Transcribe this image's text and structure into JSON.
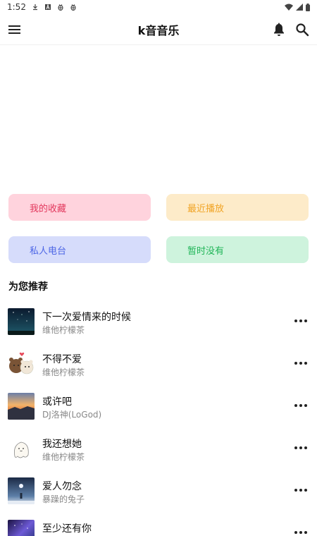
{
  "status_bar": {
    "time": "1:52",
    "icons": [
      "download-icon",
      "a-icon",
      "bug-icon",
      "bug-icon",
      "wifi-icon",
      "signal-icon",
      "battery-icon"
    ]
  },
  "app_bar": {
    "title": "k音音乐",
    "icons": [
      "menu-icon",
      "bell-icon",
      "search-icon"
    ]
  },
  "quick_actions": [
    {
      "label": "我的收藏",
      "bg": "#ffd3dd",
      "fg": "#e2375c"
    },
    {
      "label": "最近播放",
      "bg": "#fdebc9",
      "fg": "#f1a425"
    },
    {
      "label": "私人电台",
      "bg": "#d6dcfb",
      "fg": "#4d66e6"
    },
    {
      "label": "暂时没有",
      "bg": "#cef3dd",
      "fg": "#20b558"
    }
  ],
  "section": {
    "title": "为您推荐"
  },
  "songs": [
    {
      "title": "下一次爱情来的时候",
      "artist": "维他柠檬茶",
      "cover": "night-sky"
    },
    {
      "title": "不得不爱",
      "artist": "维他柠檬茶",
      "cover": "bears"
    },
    {
      "title": "或许吧",
      "artist": "DJ洛神(LoGod)",
      "cover": "sunset"
    },
    {
      "title": "我还想她",
      "artist": "维他柠檬茶",
      "cover": "ghost"
    },
    {
      "title": "爱人勿念",
      "artist": "暴躁的兔子",
      "cover": "moon-scene"
    },
    {
      "title": "至少还有你",
      "artist": "",
      "cover": "galaxy"
    }
  ],
  "more_icon": "more-horizontal-icon"
}
